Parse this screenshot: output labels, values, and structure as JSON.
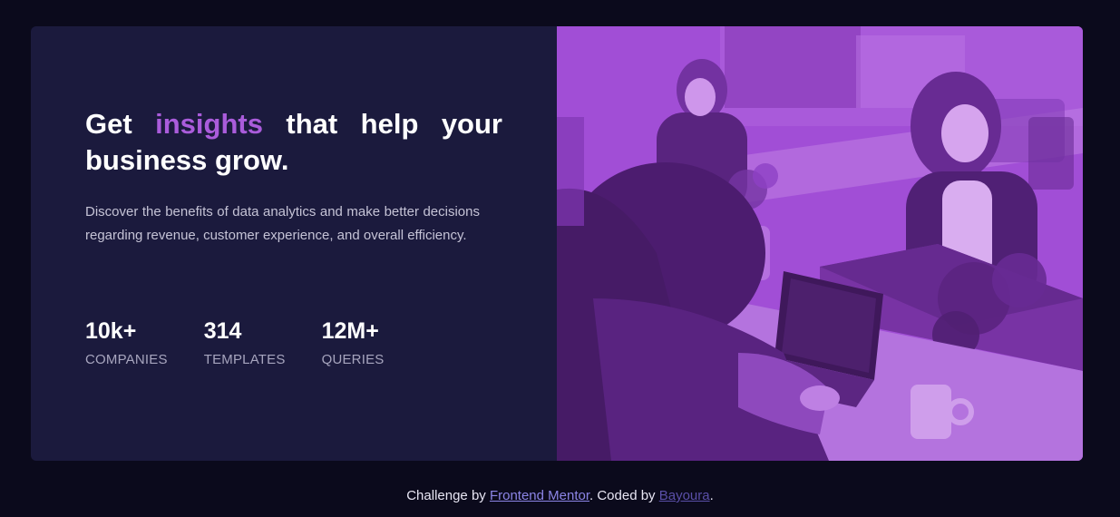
{
  "hero": {
    "title_pre": "Get ",
    "title_accent": "insights",
    "title_post": " that help your business grow.",
    "description": "Discover the benefits of data analytics and make better decisions regarding revenue, customer experience, and overall efficiency."
  },
  "stats": [
    {
      "value": "10k+",
      "label": "Companies"
    },
    {
      "value": "314",
      "label": "Templates"
    },
    {
      "value": "12M+",
      "label": "Queries"
    }
  ],
  "footer": {
    "prefix": "Challenge by ",
    "link1": "Frontend Mentor",
    "middle": ". Coded by ",
    "link2": "Bayoura",
    "suffix": "."
  },
  "colors": {
    "background": "#0b0a1c",
    "card": "#1b1a3d",
    "accent": "#aa5cdb",
    "photo_tint": "#a24fd6"
  }
}
